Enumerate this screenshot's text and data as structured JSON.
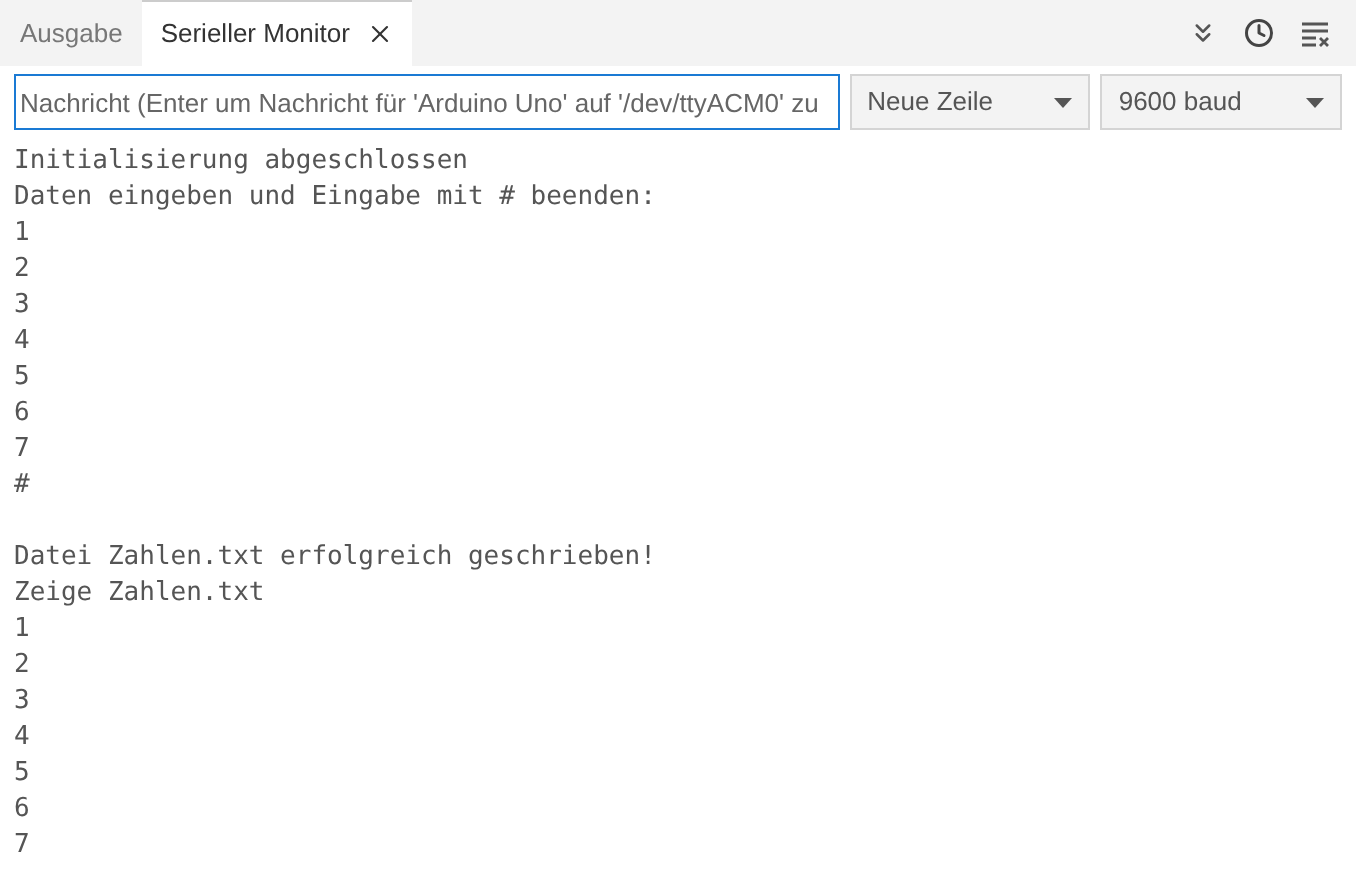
{
  "tabs": [
    {
      "label": "Ausgabe",
      "selected": false,
      "closable": false
    },
    {
      "label": "Serieller Monitor",
      "selected": true,
      "closable": true
    }
  ],
  "message_field": {
    "placeholder": "Nachricht (Enter um Nachricht für 'Arduino Uno' auf '/dev/ttyACM0' zu"
  },
  "line_ending": {
    "value": "Neue Zeile"
  },
  "baud_rate": {
    "value": "9600 baud"
  },
  "output": [
    [
      "Initialisierung abgeschlossen",
      "Daten eingeben und Eingabe mit # beenden:",
      "1",
      "2",
      "3",
      "4",
      "5",
      "6",
      "7",
      "#"
    ],
    [
      "Datei Zahlen.txt erfolgreich geschrieben!",
      "Zeige Zahlen.txt",
      "1",
      "2",
      "3",
      "4",
      "5",
      "6",
      "7"
    ]
  ]
}
